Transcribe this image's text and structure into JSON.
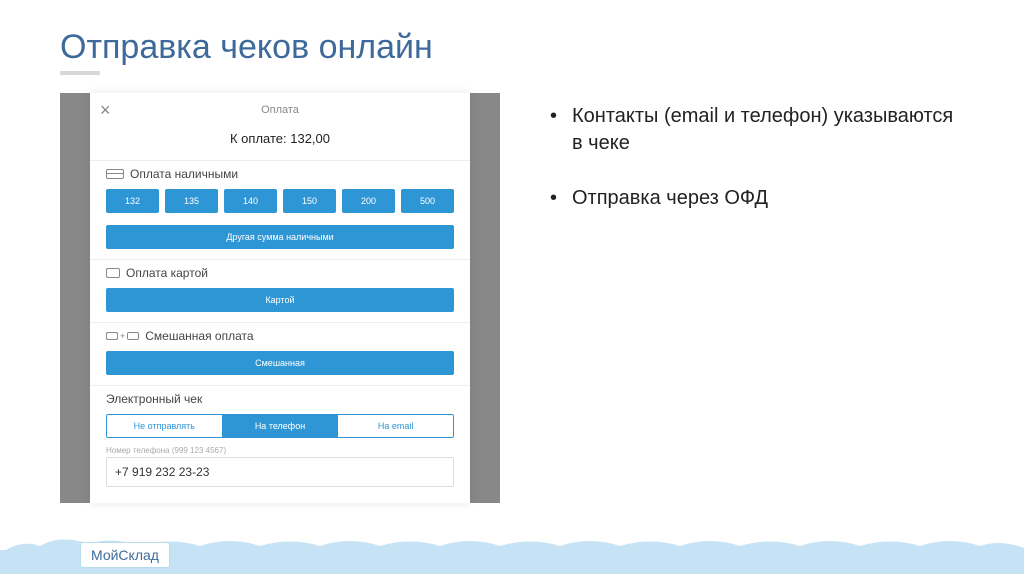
{
  "slide": {
    "title": "Отправка чеков онлайн",
    "bullets": [
      "Контакты (email и телефон) указываются в чеке",
      "Отправка через ОФД"
    ]
  },
  "app": {
    "header_title": "Оплата",
    "total_label": "К оплате: 132,00",
    "cash": {
      "label": "Оплата наличными",
      "amounts": [
        "132",
        "135",
        "140",
        "150",
        "200",
        "500"
      ],
      "other": "Другая сумма наличными"
    },
    "card": {
      "label": "Оплата картой",
      "button": "Картой"
    },
    "mixed": {
      "label": "Смешанная оплата",
      "button": "Смешанная"
    },
    "echeck": {
      "label": "Электронный чек",
      "options": [
        "Не отправлять",
        "На телефон",
        "На email"
      ],
      "active_index": 1,
      "phone_hint": "Номер телефона (999 123 4567)",
      "phone_value": "+7 919 232 23-23"
    }
  },
  "footer": {
    "logo_text": "МойСклад"
  }
}
